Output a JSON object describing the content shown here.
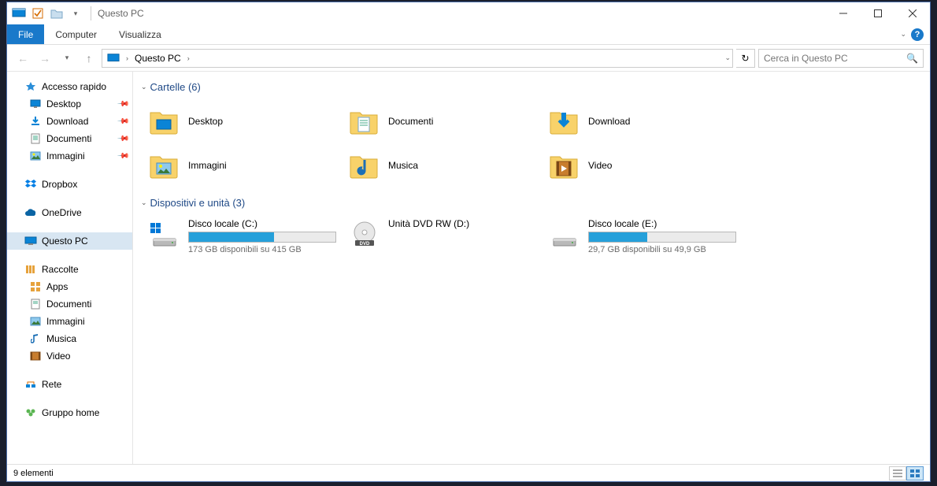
{
  "title": "Questo PC",
  "ribbon": {
    "file": "File",
    "tabs": [
      "Computer",
      "Visualizza"
    ]
  },
  "breadcrumbs": [
    "Questo PC"
  ],
  "search_placeholder": "Cerca in Questo PC",
  "sidebar": {
    "quick_access": "Accesso rapido",
    "quick_items": [
      {
        "label": "Desktop",
        "icon": "desktop"
      },
      {
        "label": "Download",
        "icon": "download"
      },
      {
        "label": "Documenti",
        "icon": "document"
      },
      {
        "label": "Immagini",
        "icon": "pictures"
      }
    ],
    "dropbox": "Dropbox",
    "onedrive": "OneDrive",
    "thispc": "Questo PC",
    "libraries": "Raccolte",
    "lib_items": [
      {
        "label": "Apps",
        "icon": "apps"
      },
      {
        "label": "Documenti",
        "icon": "document"
      },
      {
        "label": "Immagini",
        "icon": "pictures"
      },
      {
        "label": "Musica",
        "icon": "music"
      },
      {
        "label": "Video",
        "icon": "video"
      }
    ],
    "network": "Rete",
    "homegroup": "Gruppo home"
  },
  "sections": {
    "folders_label": "Cartelle (6)",
    "devices_label": "Dispositivi e unità (3)"
  },
  "folders": [
    {
      "label": "Desktop",
      "icon": "desktop-lg"
    },
    {
      "label": "Documenti",
      "icon": "document-lg"
    },
    {
      "label": "Download",
      "icon": "download-lg"
    },
    {
      "label": "Immagini",
      "icon": "pictures-lg"
    },
    {
      "label": "Musica",
      "icon": "music-lg"
    },
    {
      "label": "Video",
      "icon": "video-lg"
    }
  ],
  "drives": [
    {
      "label": "Disco locale (C:)",
      "sub": "173 GB disponibili su 415 GB",
      "fill_pct": 58,
      "type": "hdd-win"
    },
    {
      "label": "Unità DVD RW (D:)",
      "sub": "",
      "fill_pct": null,
      "type": "dvd"
    },
    {
      "label": "Disco locale (E:)",
      "sub": "29,7 GB disponibili su 49,9 GB",
      "fill_pct": 40,
      "type": "hdd"
    }
  ],
  "status": "9 elementi"
}
